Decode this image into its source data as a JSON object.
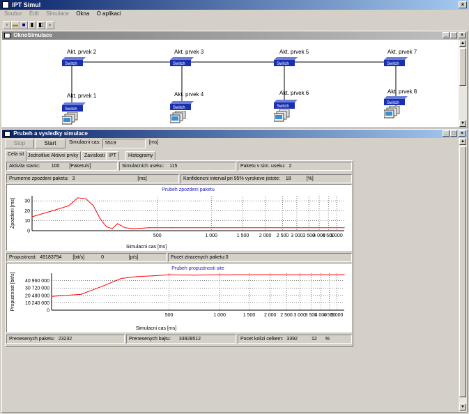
{
  "app": {
    "title": "IPT Simul",
    "menu": [
      {
        "label": "Soubor",
        "disabled": true
      },
      {
        "label": "Edit",
        "disabled": true
      },
      {
        "label": "Simulace",
        "disabled": true
      },
      {
        "label": "Okna",
        "disabled": false
      },
      {
        "label": "O aplikaci",
        "disabled": false
      }
    ]
  },
  "sim_window": {
    "title": "OknoSimulace",
    "nodes": [
      {
        "label": "Akt. prvek 2",
        "device": "Switch"
      },
      {
        "label": "Akt. prvek 3",
        "device": "Switch"
      },
      {
        "label": "Akt. prvek 5",
        "device": "Switch"
      },
      {
        "label": "Akt. prvek 7",
        "device": "Switch"
      },
      {
        "label": "Akt. prvek 1",
        "device": "Switch"
      },
      {
        "label": "Akt. prvek 4",
        "device": "Switch"
      },
      {
        "label": "Akt. prvek 6",
        "device": "Switch"
      },
      {
        "label": "Akt. prvek 8",
        "device": "Switch"
      }
    ]
  },
  "results_window": {
    "title": "Prubeh a vysledky simulace",
    "stop_label": "Stop",
    "start_label": "Start",
    "sim_time_label": "Simulacni cas:",
    "sim_time_value": "5519",
    "sim_time_unit": "[ms]",
    "tabs": [
      "Cela sit",
      "Jednotlive Aktivni prvky",
      "Zavislosti",
      "IPT",
      "Histogramy"
    ],
    "stats1": {
      "activity_label": "Aktivita stanic:",
      "activity_value": "100",
      "activity_unit": "[Paketu/s]",
      "sections_label": "Simulacnich useku:",
      "sections_value": "115",
      "packets_label": "Paketu v sim. useku:",
      "packets_value": "2"
    },
    "stats2": {
      "delay_label": "Prumerne zpozdeni paketu:",
      "delay_value": "3",
      "delay_unit": "[ms]",
      "ci_label": "Konfidencni interval pri 95% vyrokove jistote:",
      "ci_value": "18",
      "ci_unit": "[%]"
    },
    "stats3": {
      "throughput_label": "Propustnost:",
      "throughput_value": "49183794",
      "throughput_unit": "[bit/s]",
      "pps_value": "0",
      "pps_unit": "[p/s]",
      "lost_label": "Pocet ztracenych paketu:",
      "lost_value": "0"
    },
    "stats4": {
      "transferred_packets_label": "Prenesenych paketu:",
      "transferred_packets_value": "23232",
      "transferred_bytes_label": "Prenesenych bajtu:",
      "transferred_bytes_value": "33928512",
      "collisions_label": "Pocet kolizi celkem:",
      "collisions_value": "3392",
      "collision_pct": "12",
      "collision_pct_unit": "%"
    }
  },
  "chart_data": [
    {
      "type": "line",
      "title": "Prubeh zpozdeni paketu",
      "xlabel": "Simulacni cas [ms]",
      "ylabel": "Zpozdeni [ms]",
      "x_scale": "log",
      "x_tick_labels": [
        "500",
        "1 000",
        "1 500",
        "2 000",
        "2 500",
        "3 000",
        "3 500",
        "4 000",
        "4 500",
        "5 000"
      ],
      "y_ticks": [
        0,
        10,
        20,
        30
      ],
      "ylim": [
        0,
        35
      ],
      "grid": true,
      "series": [
        {
          "color": "#ff0000",
          "x": [
            100,
            130,
            160,
            180,
            200,
            220,
            240,
            260,
            280,
            300,
            330,
            370,
            450,
            600,
            1000,
            2000,
            3000,
            4000,
            5000,
            5519
          ],
          "y": [
            14,
            20,
            25,
            33,
            32,
            25,
            12,
            4,
            2,
            7,
            3,
            2,
            3,
            3,
            3,
            3,
            3,
            3,
            3,
            3
          ]
        }
      ]
    },
    {
      "type": "line",
      "title": "Prubeh propustnosti site",
      "xlabel": "Simulacni cas [ms]",
      "ylabel": "Propustnost [bit/s]",
      "x_scale": "log",
      "x_tick_labels": [
        "500",
        "1 000",
        "1 500",
        "2 000",
        "2 500",
        "3 000",
        "3 500",
        "4 000",
        "4 500",
        "5 000"
      ],
      "y_tick_labels": [
        "0",
        "10 240 000",
        "20 480 000",
        "30 720 000",
        "40 960 000"
      ],
      "ylim": [
        0,
        51200000
      ],
      "grid": true,
      "series": [
        {
          "color": "#ff0000",
          "x": [
            100,
            150,
            200,
            260,
            320,
            400,
            500,
            700,
            1000,
            2000,
            3000,
            5519
          ],
          "y": [
            19000000,
            22000000,
            33000000,
            44000000,
            46500000,
            47500000,
            49000000,
            48500000,
            49000000,
            49200000,
            49100000,
            49183794
          ]
        }
      ]
    }
  ]
}
